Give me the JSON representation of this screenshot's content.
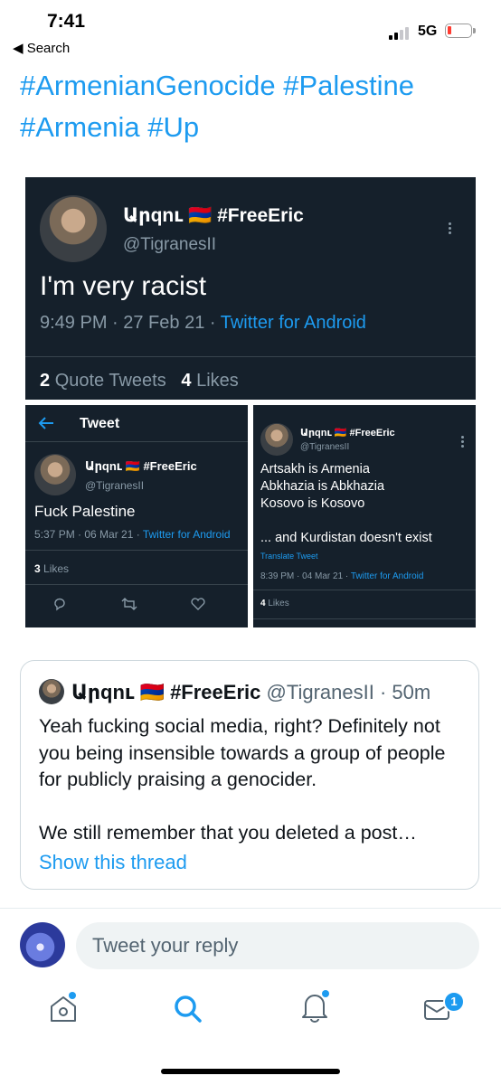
{
  "status_bar": {
    "time": "7:41",
    "back_label": "◀ Search",
    "network": "5G"
  },
  "tweet_text": {
    "hashtags": "#ArmenianGenocide #Palestine #Armenia #Up"
  },
  "shot1": {
    "display_name": "Արqnւ 🇦🇲 #FreeEric",
    "handle": "@TigranesII",
    "text": "I'm very racist",
    "time": "9:49 PM · 27 Feb 21 · ",
    "source": "Twitter for Android",
    "quote_count": "2",
    "quote_label": "Quote Tweets",
    "like_count": "4",
    "like_label": "Likes"
  },
  "shot2": {
    "header_title": "Tweet",
    "display_name": "Արqnւ 🇦🇲 #FreeEric",
    "handle": "@TigranesII",
    "text": "Fuck Palestine",
    "time": "5:37 PM · 06 Mar 21 · ",
    "source": "Twitter for Android",
    "like_count": "3",
    "like_label": "Likes"
  },
  "shot3": {
    "display_name": "Արqnւ 🇦🇲 #FreeEric",
    "handle": "@TigranesII",
    "lines": [
      "Artsakh is Armenia",
      "Abkhazia is Abkhazia",
      "Kosovo is Kosovo",
      "",
      "... and Kurdistan doesn't exist"
    ],
    "translate": "Translate Tweet",
    "time": "8:39 PM · 04 Mar 21 · ",
    "source": "Twitter for Android",
    "like_count": "4",
    "like_label": "Likes"
  },
  "quote": {
    "display_name": "Արqnւ 🇦🇲 #FreeEric",
    "handle": "@TigranesII",
    "age": "· 50m",
    "paragraph1": "Yeah fucking social media, right? Definitely not you being insensible towards a group of people for publicly praising a genocider.",
    "paragraph2": "We still remember that you deleted a post…",
    "show_thread": "Show this thread"
  },
  "reply": {
    "placeholder": "Tweet your reply"
  },
  "tabbar": {
    "messages_badge": "1",
    "accent": "#1d9bf0"
  }
}
